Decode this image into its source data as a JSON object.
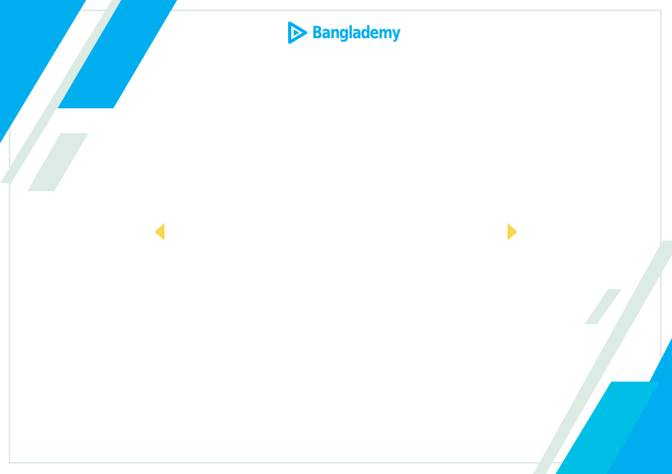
{
  "brand": {
    "name": "Banglademy",
    "logo_icon": "play-triangle-icon"
  },
  "navigation": {
    "prev_icon": "caret-left-icon",
    "next_icon": "caret-right-icon"
  },
  "colors": {
    "brand_blue": "#00aeef",
    "brand_cyan": "#00bfe7",
    "mint_stripe": "#dcebe4",
    "arrow_yellow": "#f9d54a",
    "frame_border": "#dfeae5",
    "background": "#ffffff"
  }
}
